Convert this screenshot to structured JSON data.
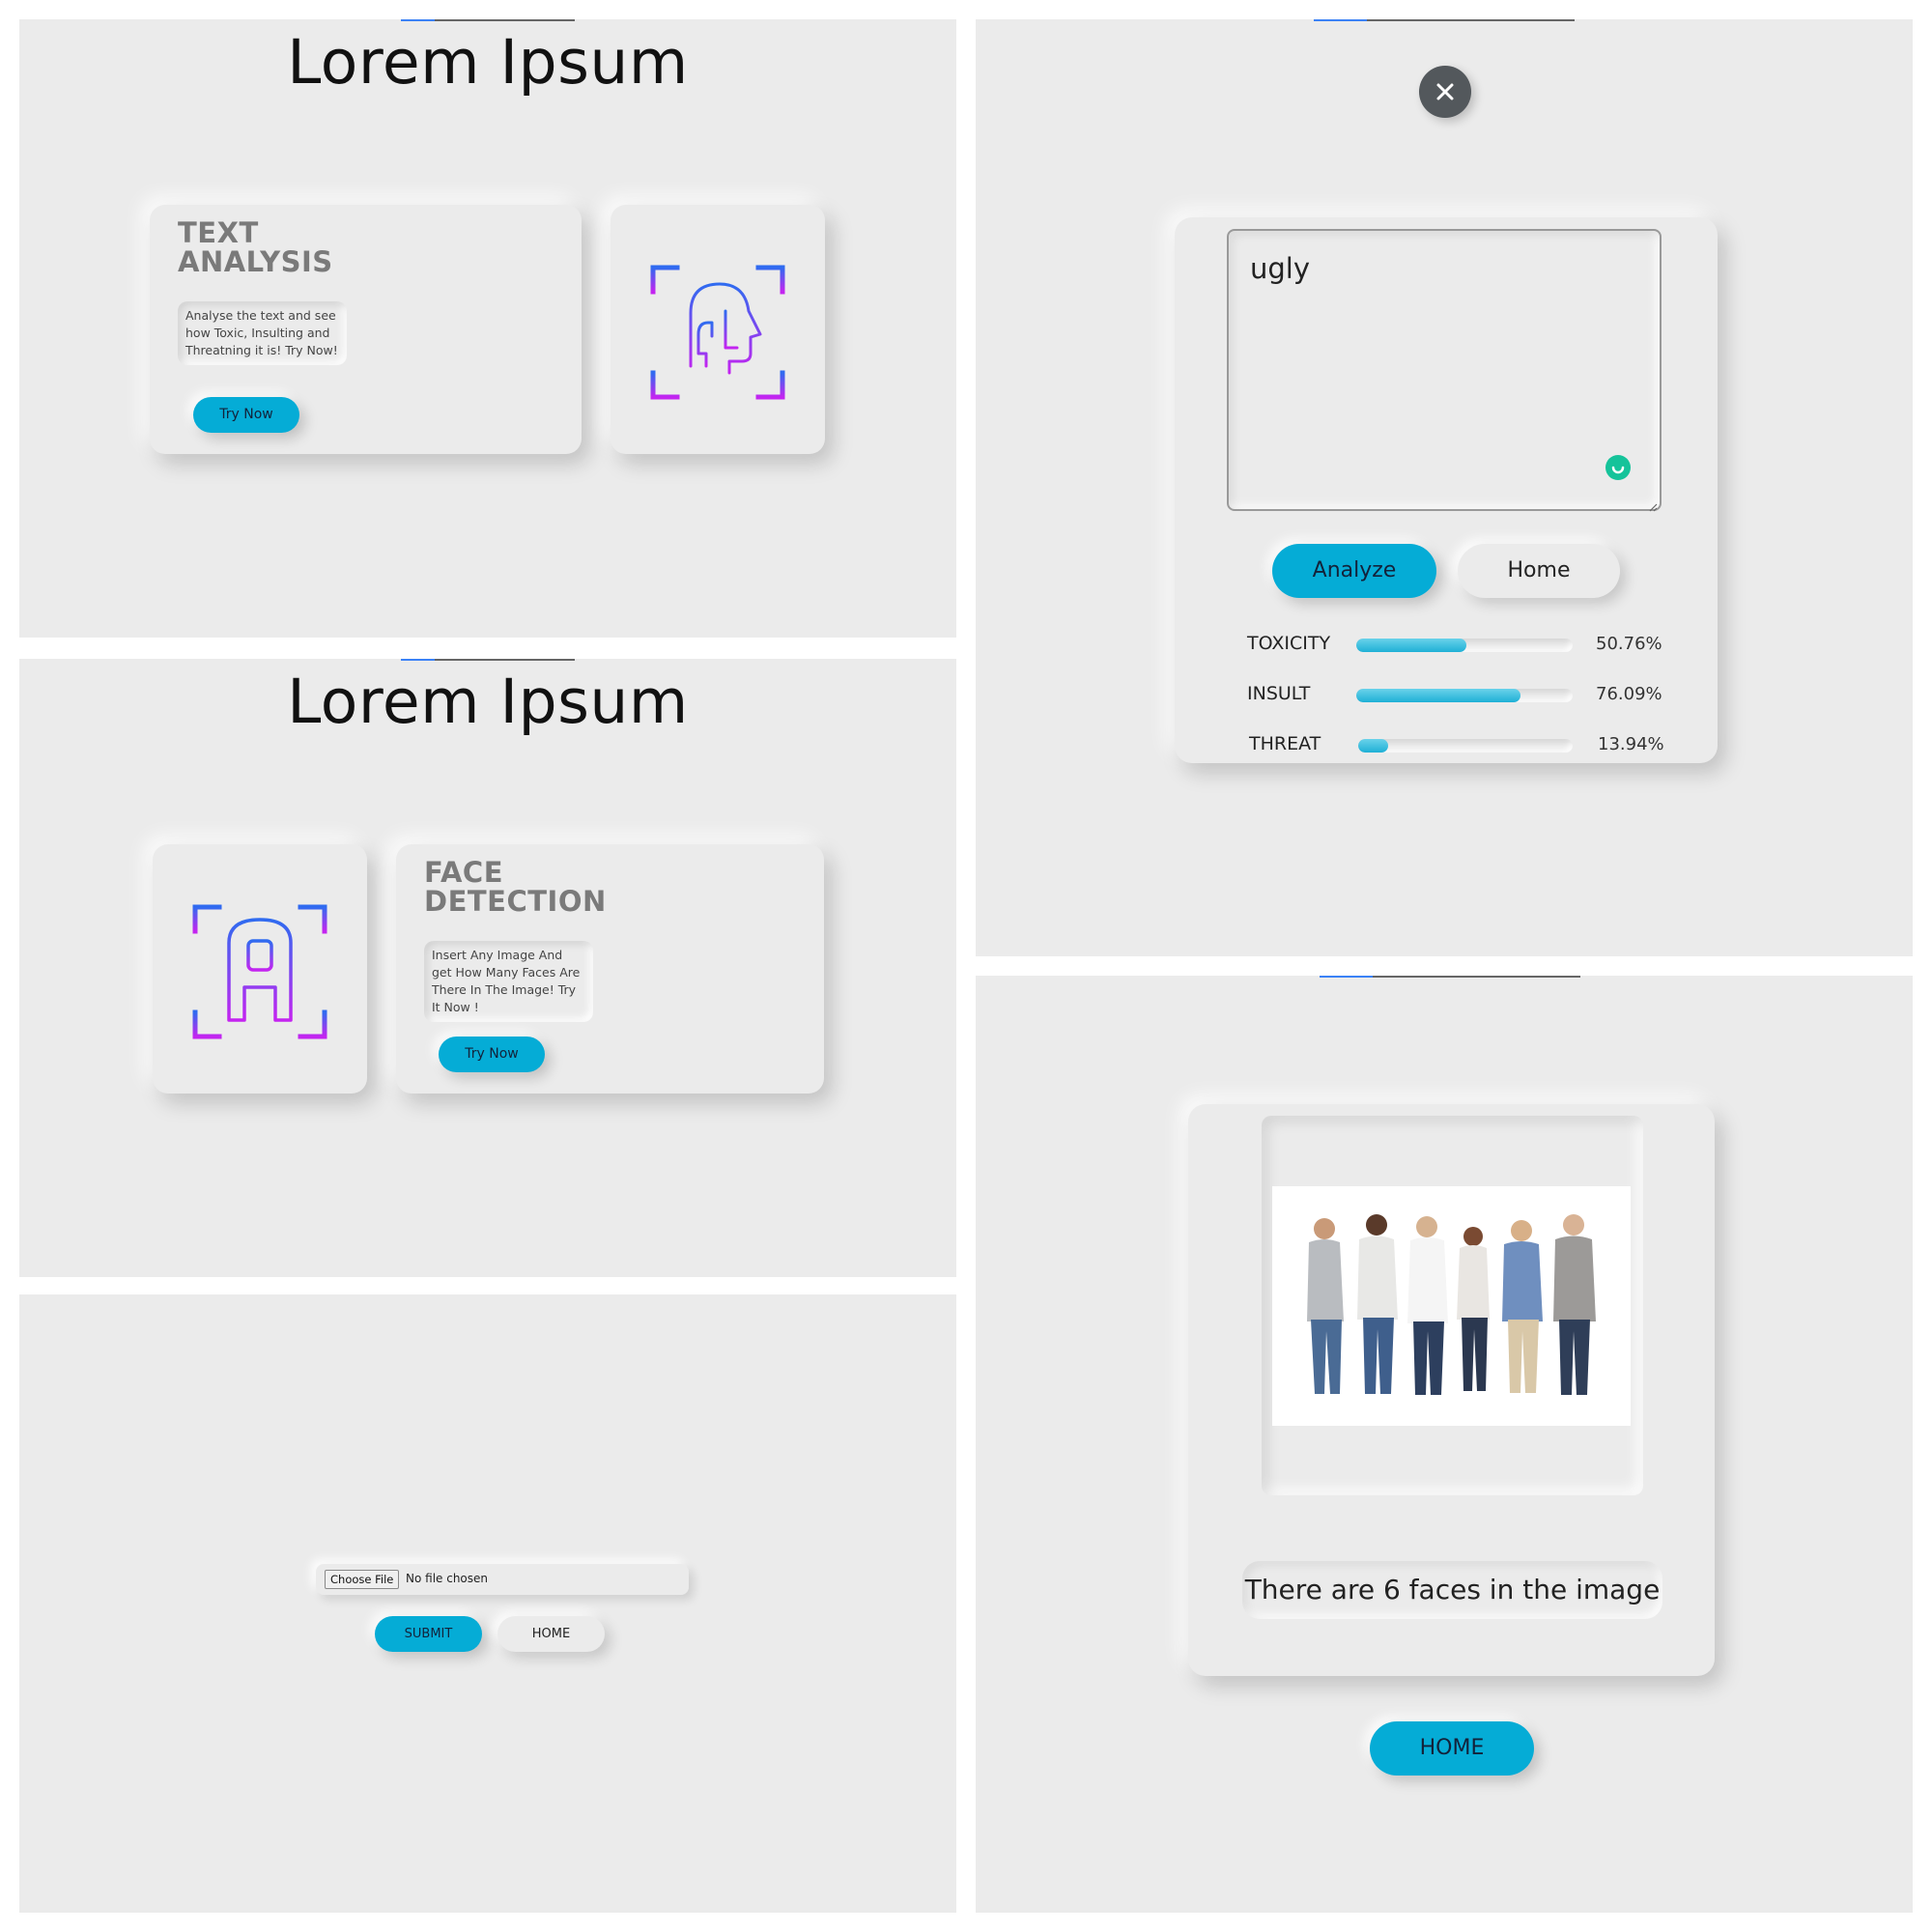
{
  "panel1": {
    "title": "Lorem Ipsum",
    "card_title_line1": "TEXT",
    "card_title_line2": "ANALYSIS",
    "card_desc": "Analyse the text and see how Toxic, Insulting and Threatning it is! Try Now!",
    "button": "Try Now",
    "icon": "face-scan-icon"
  },
  "panel2": {
    "title": "Lorem Ipsum",
    "card_title_line1": "FACE",
    "card_title_line2": "DETECTION",
    "card_desc": "Insert Any Image And get How Many Faces Are There In The Image! Try It Now !",
    "button": "Try Now",
    "icon": "text-scan-icon"
  },
  "panel3": {
    "choose_file": "Choose File",
    "no_file": "No file chosen",
    "submit": "SUBMIT",
    "home": "HOME"
  },
  "panel4": {
    "close_icon": "close-icon",
    "textarea_value": "ugly",
    "analyze": "Analyze",
    "home": "Home",
    "metrics": [
      {
        "label": "TOXICITY",
        "value": "50.76%",
        "fraction": 0.5076
      },
      {
        "label": "INSULT",
        "value": "76.09%",
        "fraction": 0.7609
      },
      {
        "label": "THREAT",
        "value": "13.94%",
        "fraction": 0.1394
      }
    ]
  },
  "panel5": {
    "result": "There are 6 faces in the image",
    "home": "HOME"
  },
  "colors": {
    "accent": "#05acd6",
    "panel_bg": "#ebebeb",
    "icon_gradient_start": "#2f6bf0",
    "icon_gradient_end": "#c424f0"
  }
}
